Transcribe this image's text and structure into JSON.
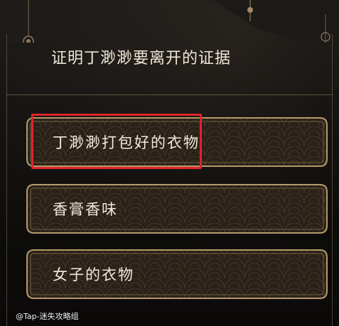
{
  "question": {
    "text": "证明丁渺渺要离开的证据"
  },
  "options": [
    {
      "label": "丁渺渺打包好的衣物",
      "highlighted": true
    },
    {
      "label": "香膏香味",
      "highlighted": false
    },
    {
      "label": "女子的衣物",
      "highlighted": false
    }
  ],
  "watermark": "@Tap-迷失攻略组",
  "colors": {
    "background": "#0d0c0b",
    "option_fill": "#2a2119",
    "option_border": "#b59a6a",
    "highlight": "#e0242c",
    "text": "#f1e9da"
  }
}
